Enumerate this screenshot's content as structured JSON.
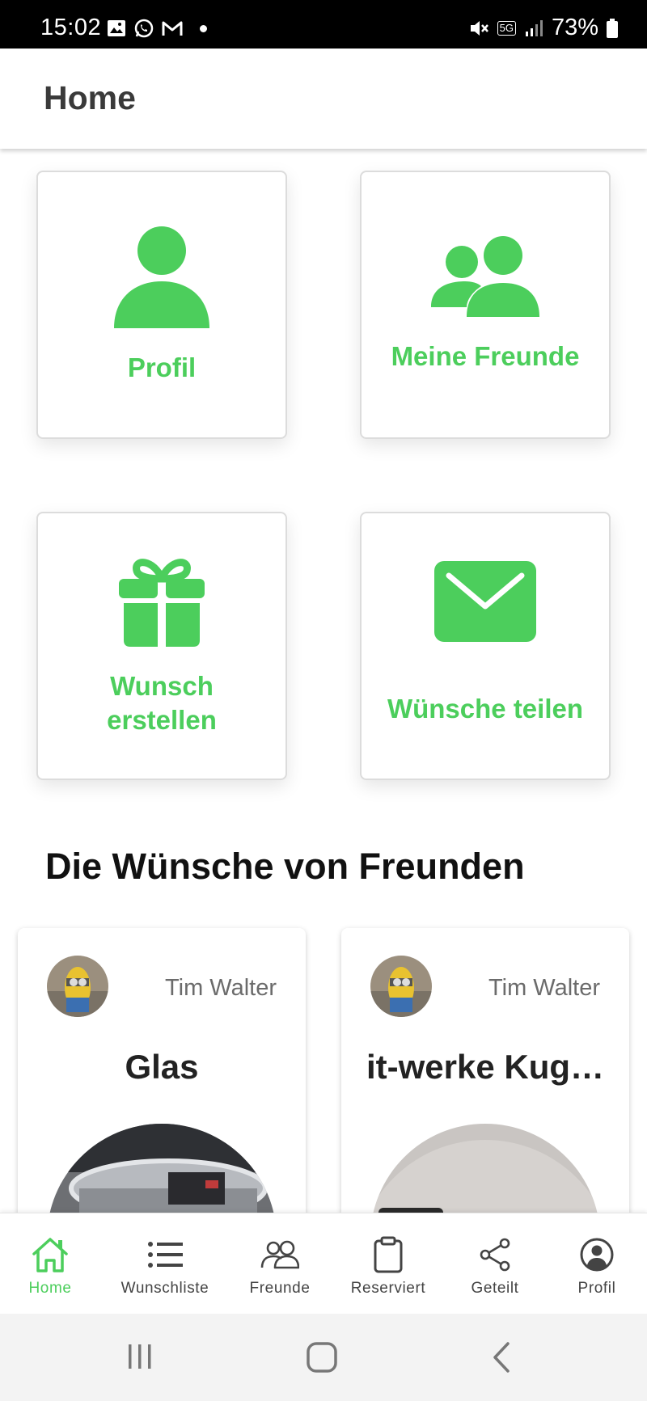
{
  "colors": {
    "accent": "#4cce5c",
    "text_dark": "#222222",
    "text_muted": "#6b6b6b"
  },
  "status_bar": {
    "time": "15:02",
    "battery": "73%",
    "network": "5G"
  },
  "app_bar": {
    "title": "Home"
  },
  "tiles": [
    {
      "label": "Profil",
      "icon": "person-icon"
    },
    {
      "label": "Meine Freunde",
      "icon": "friends-icon"
    },
    {
      "label": "Wunsch erstellen",
      "icon": "gift-icon"
    },
    {
      "label": "Wünsche teilen",
      "icon": "mail-icon"
    }
  ],
  "section": {
    "title": "Die Wünsche von Freunden"
  },
  "wishes": [
    {
      "owner": "Tim Walter",
      "title": "Glas"
    },
    {
      "owner": "Tim Walter",
      "title": "it-werke Kug…"
    }
  ],
  "bottom_nav": {
    "active": "Home",
    "items": [
      {
        "label": "Home",
        "icon": "home-icon"
      },
      {
        "label": "Wunschliste",
        "icon": "list-icon"
      },
      {
        "label": "Freunde",
        "icon": "friends-outline-icon"
      },
      {
        "label": "Reserviert",
        "icon": "clipboard-icon"
      },
      {
        "label": "Geteilt",
        "icon": "share-icon"
      },
      {
        "label": "Profil",
        "icon": "profile-circle-icon"
      }
    ]
  }
}
